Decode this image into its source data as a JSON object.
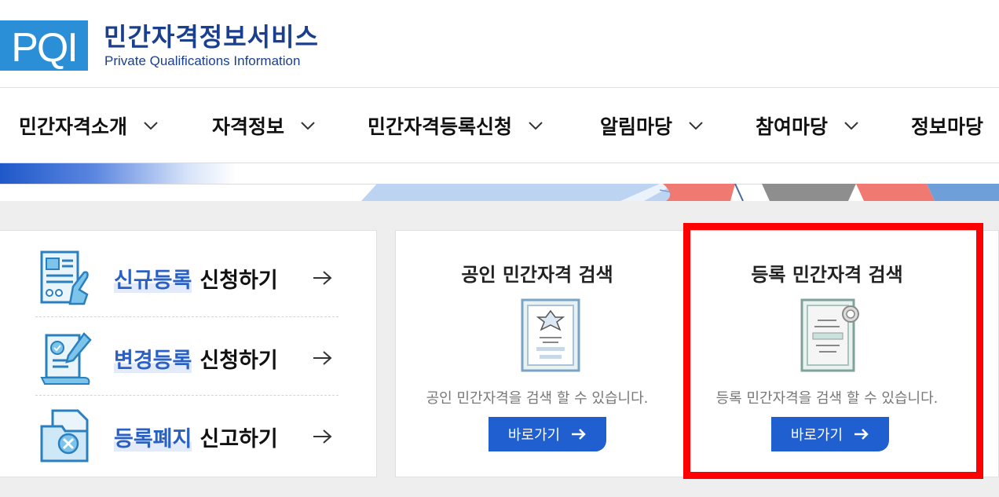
{
  "header": {
    "logo_mark": "PQI",
    "title": "민간자격정보서비스",
    "subtitle": "Private Qualifications Information"
  },
  "nav": {
    "items": [
      {
        "label": "민간자격소개"
      },
      {
        "label": "자격정보"
      },
      {
        "label": "민간자격등록신청"
      },
      {
        "label": "알림마당"
      },
      {
        "label": "참여마당"
      },
      {
        "label": "정보마당"
      }
    ]
  },
  "registration": {
    "items": [
      {
        "highlight": "신규등록",
        "rest": "신청하기",
        "icon": "new-registration-form-icon"
      },
      {
        "highlight": "변경등록",
        "rest": "신청하기",
        "icon": "change-registration-icon"
      },
      {
        "highlight": "등록폐지",
        "rest": "신고하기",
        "icon": "registration-cancel-icon"
      }
    ]
  },
  "search": {
    "public": {
      "title": "공인 민간자격 검색",
      "desc": "공인 민간자격을 검색 할 수 있습니다.",
      "button": "바로가기"
    },
    "registered": {
      "title": "등록 민간자격 검색",
      "desc": "등록 민간자격을 검색 할 수 있습니다.",
      "button": "바로가기"
    }
  },
  "colors": {
    "brand_blue": "#1b3f8f",
    "button_blue": "#1f5fd0",
    "highlight_red": "#ff0000"
  }
}
